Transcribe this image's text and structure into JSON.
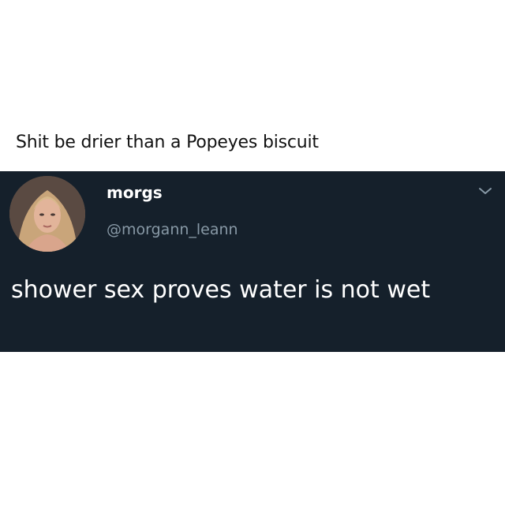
{
  "caption": "Shit be drier than a Popeyes biscuit",
  "tweet": {
    "display_name": "morgs",
    "handle": "@morgann_leann",
    "text": "shower sex proves water is not wet",
    "menu_icon": "chevron-down-icon",
    "background_color": "#15202b",
    "handle_color": "#8899a6"
  }
}
